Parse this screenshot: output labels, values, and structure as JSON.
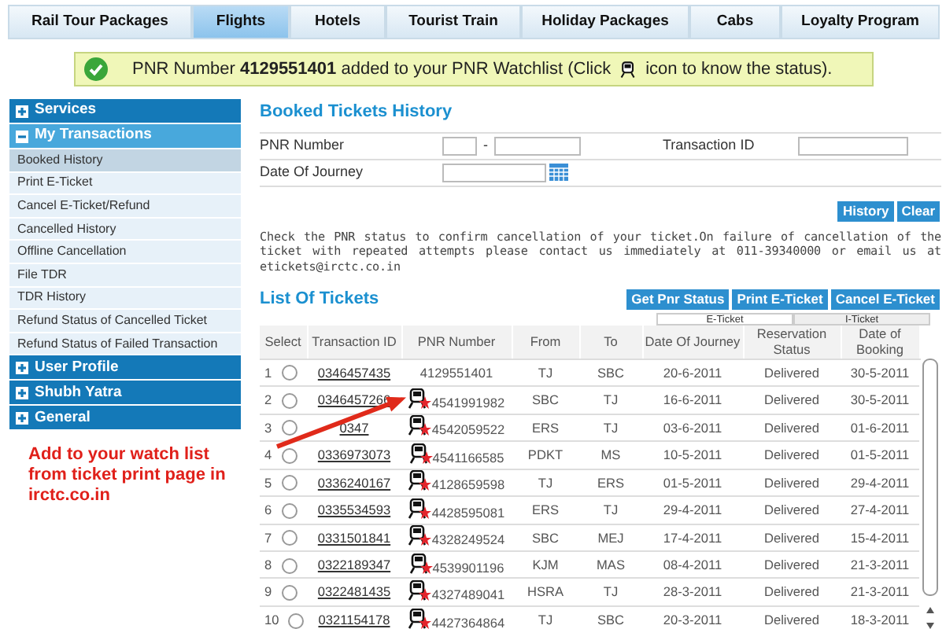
{
  "tabs": [
    {
      "label": "Rail Tour Packages",
      "selected": false
    },
    {
      "label": "Flights",
      "selected": true
    },
    {
      "label": "Hotels",
      "selected": false
    },
    {
      "label": "Tourist Train",
      "selected": false
    },
    {
      "label": "Holiday Packages",
      "selected": false
    },
    {
      "label": "Cabs",
      "selected": false
    },
    {
      "label": "Loyalty Program",
      "selected": false
    }
  ],
  "banner": {
    "text": "PNR Number **4129551401** added to your PNR Watchlist (Click",
    "text_after": "icon to know the status)."
  },
  "sidebar": [
    {
      "label": "Services",
      "expanded": false
    },
    {
      "label": "My Transactions",
      "expanded": true,
      "children": [
        {
          "label": "Booked History",
          "selected": true
        },
        {
          "label": "Print E-Ticket",
          "selected": false
        },
        {
          "label": "Cancel E-Ticket/Refund",
          "selected": false
        },
        {
          "label": "Cancelled History",
          "selected": false
        },
        {
          "label": "Offline Cancellation",
          "selected": false
        },
        {
          "label": "File TDR",
          "selected": false
        },
        {
          "label": "TDR History",
          "selected": false
        },
        {
          "label": "Refund Status of Cancelled Ticket",
          "selected": false
        },
        {
          "label": "Refund Status of Failed Transaction",
          "selected": false
        }
      ]
    },
    {
      "label": "User Profile",
      "expanded": false
    },
    {
      "label": "Shubh Yatra",
      "expanded": false
    },
    {
      "label": "General",
      "expanded": false
    }
  ],
  "history": {
    "title": "Booked Tickets History",
    "pnr_label": "PNR Number",
    "dash": "-",
    "transaction_label": "Transaction ID",
    "date_label": "Date Of Journey",
    "buttons": [
      "History",
      "Clear"
    ]
  },
  "notice": "Check the PNR status to confirm cancellation of your ticket.On failure of cancellation of the ticket with repeated attempts please contact us immediately at 011-39340000 or email us at etickets@irctc.co.in",
  "list": {
    "title": "List Of Tickets",
    "buttons": [
      "Get Pnr Status",
      "Print E-Ticket",
      "Cancel E-Ticket"
    ],
    "ticket_types": [
      {
        "label": "E-Ticket",
        "selected": true
      },
      {
        "label": "I-Ticket",
        "selected": false
      }
    ],
    "columns": [
      "Select",
      "Transaction ID",
      "PNR Number",
      "From",
      "To",
      "Date Of Journey",
      "Reservation Status",
      "Date of Booking"
    ],
    "rows": [
      {
        "no": "1",
        "selected": false,
        "transaction": "0346457435",
        "pnr": "4129551401",
        "watch_icon": false,
        "from": "TJ",
        "to": "SBC",
        "journey": "20-6-2011",
        "status": "Delivered",
        "booking": "30-5-2011"
      },
      {
        "no": "2",
        "selected": false,
        "transaction": "0346457266",
        "pnr": "4541991982",
        "watch_icon": true,
        "from": "SBC",
        "to": "TJ",
        "journey": "16-6-2011",
        "status": "Delivered",
        "booking": "30-5-2011"
      },
      {
        "no": "3",
        "selected": false,
        "transaction": "0347",
        "pnr": "4542059522",
        "watch_icon": true,
        "from": "ERS",
        "to": "TJ",
        "journey": "03-6-2011",
        "status": "Delivered",
        "booking": "01-6-2011"
      },
      {
        "no": "4",
        "selected": false,
        "transaction": "0336973073",
        "pnr": "4541166585",
        "watch_icon": true,
        "from": "PDKT",
        "to": "MS",
        "journey": "10-5-2011",
        "status": "Delivered",
        "booking": "01-5-2011"
      },
      {
        "no": "5",
        "selected": false,
        "transaction": "0336240167",
        "pnr": "4128659598",
        "watch_icon": true,
        "from": "TJ",
        "to": "ERS",
        "journey": "01-5-2011",
        "status": "Delivered",
        "booking": "29-4-2011"
      },
      {
        "no": "6",
        "selected": false,
        "transaction": "0335534593",
        "pnr": "4428595081",
        "watch_icon": true,
        "from": "ERS",
        "to": "TJ",
        "journey": "29-4-2011",
        "status": "Delivered",
        "booking": "27-4-2011"
      },
      {
        "no": "7",
        "selected": false,
        "transaction": "0331501841",
        "pnr": "4328249524",
        "watch_icon": true,
        "from": "SBC",
        "to": "MEJ",
        "journey": "17-4-2011",
        "status": "Delivered",
        "booking": "15-4-2011"
      },
      {
        "no": "8",
        "selected": false,
        "transaction": "0322189347",
        "pnr": "4539901196",
        "watch_icon": true,
        "from": "KJM",
        "to": "MAS",
        "journey": "08-4-2011",
        "status": "Delivered",
        "booking": "21-3-2011"
      },
      {
        "no": "9",
        "selected": false,
        "transaction": "0322481435",
        "pnr": "4327489041",
        "watch_icon": true,
        "from": "HSRA",
        "to": "TJ",
        "journey": "28-3-2011",
        "status": "Delivered",
        "booking": "21-3-2011"
      },
      {
        "no": "10",
        "selected": false,
        "transaction": "0321154178",
        "pnr": "4427364864",
        "watch_icon": true,
        "from": "TJ",
        "to": "SBC",
        "journey": "20-3-2011",
        "status": "Delivered",
        "booking": "18-3-2011"
      }
    ]
  },
  "callout": "Add to your watch list from ticket print page in irctc.co.in"
}
